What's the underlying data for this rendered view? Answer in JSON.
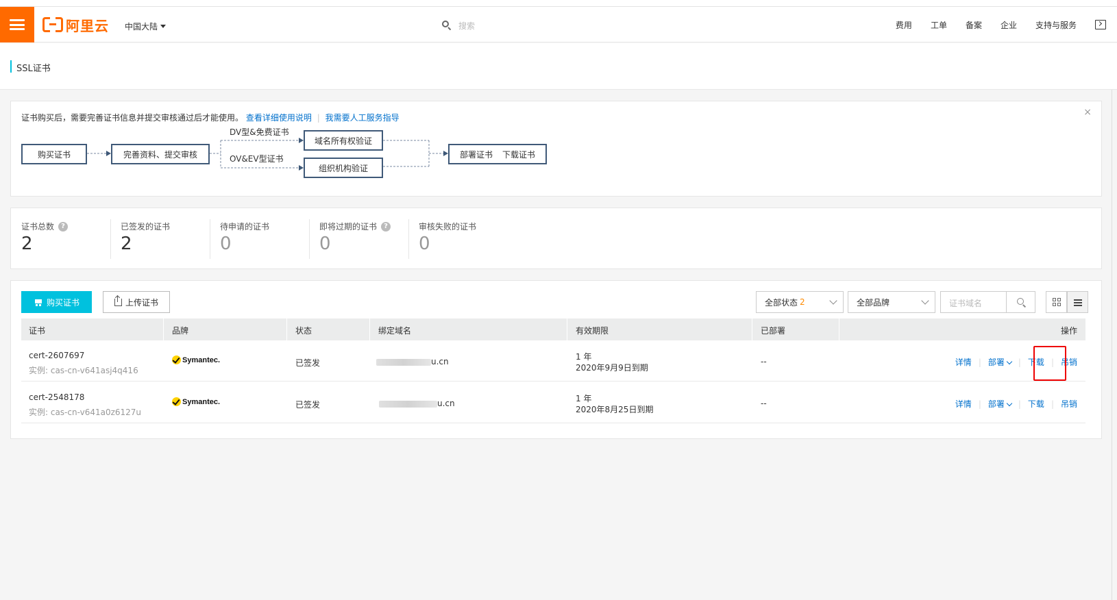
{
  "header": {
    "logo_text": "阿里云",
    "region": "中国大陆",
    "search_placeholder": "搜索",
    "nav": [
      "费用",
      "工单",
      "备案",
      "企业",
      "支持与服务"
    ]
  },
  "page": {
    "title": "SSL证书"
  },
  "guide": {
    "notice": "证书购买后，需要完善证书信息并提交审核通过后才能使用。",
    "link_docs": "查看详细使用说明",
    "link_help": "我需要人工服务指导",
    "close": "×",
    "flow": {
      "buy": "购买证书",
      "complete": "完善资料、提交审核",
      "dv_label": "DV型&免费证书",
      "ov_label": "OV&EV型证书",
      "domain_verify": "域名所有权验证",
      "org_verify": "组织机构验证",
      "deploy": "部署证书",
      "download": "下载证书"
    }
  },
  "stats": [
    {
      "label": "证书总数",
      "value": "2",
      "help": true
    },
    {
      "label": "已签发的证书",
      "value": "2",
      "help": false
    },
    {
      "label": "待申请的证书",
      "value": "0",
      "help": false
    },
    {
      "label": "即将过期的证书",
      "value": "0",
      "help": true
    },
    {
      "label": "审核失败的证书",
      "value": "0",
      "help": false
    }
  ],
  "toolbar": {
    "buy_label": "购买证书",
    "upload_label": "上传证书",
    "status_filter": "全部状态",
    "status_count": "2",
    "brand_filter": "全部品牌",
    "domain_placeholder": "证书域名"
  },
  "table": {
    "columns": [
      "证书",
      "品牌",
      "状态",
      "绑定域名",
      "有效期限",
      "已部署",
      "操作"
    ],
    "rows": [
      {
        "cert": "cert-2607697",
        "instance": "实例: cas-cn-v641asj4q416",
        "brand": "Symantec.",
        "status": "已签发",
        "domain_suffix": "u.cn",
        "period": "1 年",
        "expire": "2020年9月9日到期",
        "deployed": "--"
      },
      {
        "cert": "cert-2548178",
        "instance": "实例: cas-cn-v641a0z6127u",
        "brand": "Symantec.",
        "status": "已签发",
        "domain_suffix": "u.cn",
        "period": "1 年",
        "expire": "2020年8月25日到期",
        "deployed": "--"
      }
    ],
    "actions": {
      "detail": "详情",
      "deploy": "部署",
      "download": "下载",
      "revoke": "吊销"
    }
  },
  "colors": {
    "accent": "#00c1de",
    "brand_orange": "#ff6a00",
    "link": "#0070cc",
    "highlight": "#e00000"
  }
}
